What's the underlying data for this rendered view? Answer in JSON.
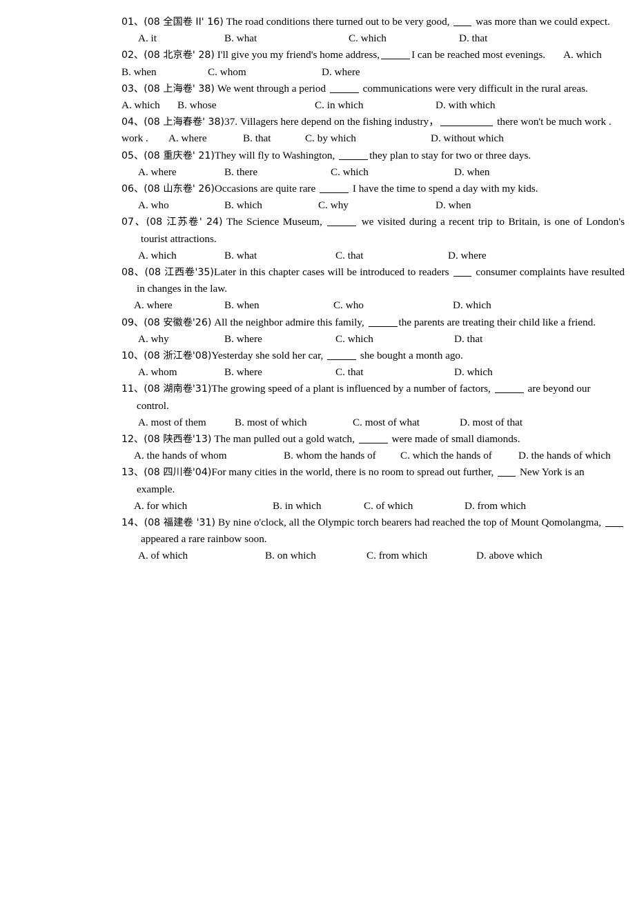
{
  "document": {
    "type": "exam-worksheet",
    "subject": "English grammar multiple choice — relative clauses",
    "background_color": "#ffffff",
    "text_color": "#000000"
  },
  "questions": [
    {
      "number": "01、",
      "source": "(08 全国卷 II' 16)",
      "stem_part1": " The road conditions there turned out to be very good, ",
      "stem_part2": " was more than we could expect.",
      "options": [
        "A. it",
        "B. what",
        "C. which",
        "D. that"
      ]
    },
    {
      "number": "02、",
      "source": "(08 北京卷' 28)",
      "stem_part1": " I'll give you my friend's home address,",
      "stem_part2": "I can be reached most evenings.",
      "options": [
        "A. which",
        "B. when",
        "C. whom",
        "D. where"
      ]
    },
    {
      "number": "03、",
      "source": "(08 上海卷' 38)",
      "stem_part1": " We went through a period ",
      "stem_part2": " communications were very difficult in the rural areas.",
      "options": [
        "A. which",
        "B. whose",
        "C. in which",
        "D. with which"
      ]
    },
    {
      "number": "04、",
      "source": "(08 上海春卷' 38)",
      "stem_part1": "37. Villagers here depend on the fishing industry，",
      "stem_part2": " there won't be much work .",
      "options": [
        "A. where",
        "B. that",
        "C. by which",
        "D. without which"
      ]
    },
    {
      "number": "05、",
      "source": "(08 重庆卷' 21)",
      "stem_part1": "They will fly to Washington, ",
      "stem_part2": "they plan to stay for two or three days.",
      "options": [
        "A. where",
        "B. there",
        "C. which",
        "D. when"
      ]
    },
    {
      "number": "06、",
      "source": "(08 山东卷' 26)",
      "stem_part1": "Occasions are quite rare ",
      "stem_part2": " I have the time to spend a day with my kids.",
      "options": [
        "A. who",
        "B. which",
        "C. why",
        "D. when"
      ]
    },
    {
      "number": "07、",
      "source": "(08 江苏卷' 24)",
      "stem_part1": " The Science Museum, ",
      "stem_part2": " we visited during a recent trip to Britain, is one of London's tourist attractions.",
      "options": [
        "A. which",
        "B. what",
        "C. that",
        "D. where"
      ]
    },
    {
      "number": "08、",
      "source": "(08 江西卷'35)",
      "stem_part1": "Later in this chapter cases will be introduced to readers ",
      "stem_part2": " consumer complaints have resulted in changes in the law.",
      "options": [
        "A. where",
        "B. when",
        "C. who",
        "D. which"
      ]
    },
    {
      "number": "09、",
      "source": "(08 安徽卷'26)",
      "stem_part1": " All the neighbor admire this family, ",
      "stem_part2": "the parents are treating their child like a friend.",
      "options": [
        "A. why",
        "B. where",
        "C. which",
        "D. that"
      ]
    },
    {
      "number": "10、",
      "source": "(08 浙江卷'08)",
      "stem_part1": "Yesterday she sold her car, ",
      "stem_part2": " she bought a month ago.",
      "options": [
        "A. whom",
        "B. where",
        "C. that",
        "D. which"
      ]
    },
    {
      "number": "11、",
      "source": "(08 湖南卷'31)",
      "stem_part1": "The growing speed of a plant is influenced by a number of factors, ",
      "stem_part2": " are beyond our control.",
      "options": [
        "A.  most of them",
        "B. most of which",
        "C. most of what",
        "D. most of that"
      ]
    },
    {
      "number": "12、",
      "source": "(08 陕西卷'13)",
      "stem_part1": " The man pulled out a gold watch, ",
      "stem_part2": " were made of small diamonds.",
      "options": [
        "A. the hands of whom",
        "B. whom the hands of",
        "C. which the hands of",
        "D. the hands of which"
      ]
    },
    {
      "number": "13、",
      "source": "(08 四川卷'04)",
      "stem_part1": "For many cities in the world, there is no room to spread out further, ",
      "stem_part2": " New York is an example.",
      "options": [
        "A. for which",
        "B. in which",
        "C. of which",
        "D. from which"
      ]
    },
    {
      "number": "14、",
      "source": "(08 福建卷 '31)",
      "stem_part1": " By nine o'clock, all the Olympic torch bearers had reached the top of Mount Qomolangma, ",
      "stem_part2": " appeared a rare rainbow soon.",
      "options": [
        "A. of which",
        "B. on which",
        "C. from which",
        "D. above which"
      ]
    }
  ],
  "fragments": {
    "work_prefix": "work .",
    "expect_tail": "expect."
  }
}
